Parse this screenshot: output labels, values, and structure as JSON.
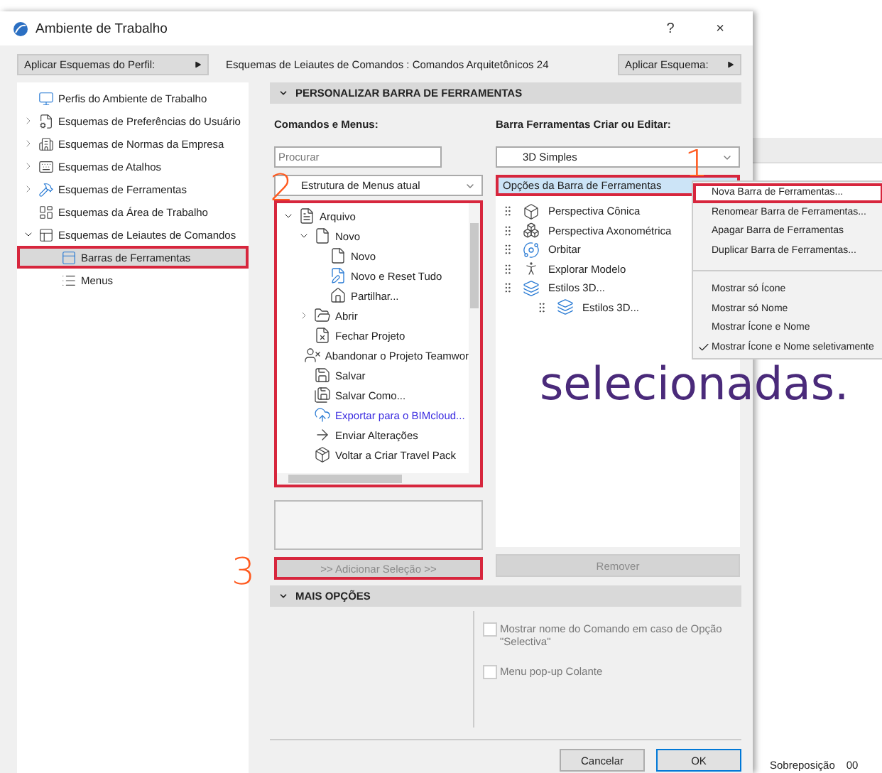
{
  "window": {
    "title": "Ambiente de Trabalho",
    "help": "?",
    "close": "×"
  },
  "top_bar": {
    "profile_button": "Aplicar Esquemas do Perfil:",
    "scheme_label": "Esquemas de Leiautes de Comandos :",
    "scheme_value": "Comandos Arquitetônicos 24",
    "apply_button": "Aplicar Esquema:"
  },
  "sidebar": {
    "items": [
      {
        "label": "Perfis do Ambiente de Trabalho",
        "selected": false,
        "highlighted": false
      },
      {
        "label": "Esquemas de Preferências do Usuário",
        "selected": false,
        "highlighted": false,
        "expanded": false
      },
      {
        "label": "Esquemas de Normas da Empresa",
        "selected": false,
        "highlighted": false,
        "expanded": false
      },
      {
        "label": "Esquemas de Atalhos",
        "selected": false,
        "highlighted": false,
        "expanded": false
      },
      {
        "label": "Esquemas de Ferramentas",
        "selected": false,
        "highlighted": false,
        "expanded": false
      },
      {
        "label": "Esquemas da Área de Trabalho",
        "selected": false,
        "highlighted": false
      },
      {
        "label": "Esquemas de Leiautes de Comandos",
        "selected": false,
        "highlighted": false,
        "expanded": true,
        "children": [
          {
            "label": "Barras de Ferramentas",
            "selected": true,
            "highlighted": true
          },
          {
            "label": "Menus",
            "selected": false,
            "highlighted": false
          }
        ]
      }
    ]
  },
  "section": {
    "title": "PERSONALIZAR BARRA DE FERRAMENTAS",
    "expanded": true
  },
  "commands": {
    "label": "Comandos e Menus:",
    "search": {
      "placeholder": "Procurar"
    },
    "dropdown": "Estrutura de Menus atual",
    "highlighted": true,
    "tree": [
      {
        "label": "Arquivo",
        "kind": "item",
        "expanded": true,
        "children": [
          {
            "label": "Novo",
            "kind": "item",
            "expanded": true,
            "children": [
              {
                "label": "Novo",
                "kind": "item"
              },
              {
                "label": "Novo e Reset Tudo",
                "kind": "item"
              },
              {
                "label": "Partilhar...",
                "kind": "item"
              }
            ]
          },
          {
            "label": "Abrir",
            "kind": "item",
            "expanded": false
          },
          {
            "label": "Fechar Projeto",
            "kind": "item"
          },
          {
            "label": "Abandonar o Projeto Teamwor",
            "kind": "item"
          },
          {
            "label": "Salvar",
            "kind": "item"
          },
          {
            "label": "Salvar Como...",
            "kind": "item"
          },
          {
            "label": "Exportar para o BIMcloud...",
            "kind": "link"
          },
          {
            "label": "Enviar Alterações",
            "kind": "item"
          },
          {
            "label": "Voltar a Criar Travel Pack",
            "kind": "item"
          }
        ]
      }
    ],
    "add_button": {
      "label": ">> Adicionar Seleção >>",
      "disabled": true,
      "highlighted": true
    }
  },
  "toolbar_editor": {
    "label": "Barra Ferramentas Criar ou Editar:",
    "dropdown": "3D Simples",
    "options_button": {
      "label": "Opções da Barra de Ferramentas",
      "highlighted": true
    },
    "items": [
      {
        "label": "Perspectiva Cônica"
      },
      {
        "label": "Perspectiva Axonométrica"
      },
      {
        "label": "Orbitar"
      },
      {
        "label": "Explorar Modelo"
      },
      {
        "label": "Estilos 3D...",
        "children": [
          {
            "label": "Estilos 3D..."
          }
        ]
      }
    ],
    "remove_button": {
      "label": "Remover",
      "disabled": true
    }
  },
  "more_section": {
    "title": "MAIS OPÇÕES",
    "expanded": true
  },
  "checkboxes": [
    {
      "label": "Mostrar nome do Comando em caso de Opção \"Selectiva\"",
      "checked": false,
      "disabled": true
    },
    {
      "label": "Menu pop-up Colante",
      "checked": false,
      "disabled": true
    }
  ],
  "buttons": [
    {
      "label": "Cancelar",
      "default": false
    },
    {
      "label": "OK",
      "default": true
    }
  ],
  "context_menu": {
    "items": [
      {
        "kind": "item",
        "label": "Nova Barra de Ferramentas...",
        "highlighted": true,
        "checked": false
      },
      {
        "kind": "item",
        "label": "Renomear Barra de Ferramentas...",
        "highlighted": false,
        "checked": false
      },
      {
        "kind": "item",
        "label": "Apagar Barra de Ferramentas",
        "highlighted": false,
        "checked": false
      },
      {
        "kind": "item",
        "label": "Duplicar Barra de Ferramentas...",
        "highlighted": false,
        "checked": false
      },
      {
        "kind": "separator"
      },
      {
        "kind": "item",
        "label": "Mostrar só Ícone",
        "highlighted": false,
        "checked": false
      },
      {
        "kind": "item",
        "label": "Mostrar só Nome",
        "highlighted": false,
        "checked": false
      },
      {
        "kind": "item",
        "label": "Mostrar Ícone e Nome",
        "highlighted": false,
        "checked": false
      },
      {
        "kind": "item",
        "label": "Mostrar Ícone e Nome seletivamente",
        "highlighted": false,
        "checked": true
      }
    ]
  },
  "annotations": [
    {
      "label": "1"
    },
    {
      "label": "2"
    },
    {
      "label": "3"
    }
  ],
  "caption": "selecionadas.",
  "background_app": {
    "status_text": "Sobreposição",
    "status_value": "00"
  }
}
